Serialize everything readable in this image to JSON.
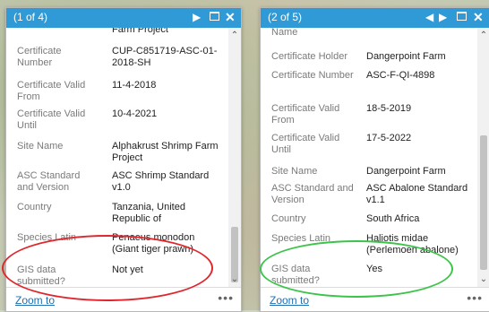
{
  "left_popup": {
    "count": "(1 of 4)",
    "partial_top": "Farm Project",
    "fields": [
      {
        "label": "Certificate Number",
        "value": "CUP-C851719-ASC-01-2018-SH"
      },
      {
        "label": "Certificate Valid From",
        "value": "11-4-2018"
      },
      {
        "label": "Certificate Valid Until",
        "value": "10-4-2021"
      },
      {
        "label": "Site Name",
        "value": "Alphakrust Shrimp Farm Project"
      },
      {
        "label": "ASC Standard and Version",
        "value": "ASC Shrimp Standard v1.0"
      },
      {
        "label": "Country",
        "value": "Tanzania, United Republic of"
      },
      {
        "label": "Species Latin",
        "value": "Penaeus monodon (Giant tiger prawn)"
      },
      {
        "label": "GIS data submitted?",
        "value": "Not yet"
      }
    ],
    "zoom_label": "Zoom to",
    "more_label": "•••"
  },
  "right_popup": {
    "count": "(2 of 5)",
    "partial_top": "Name",
    "fields": [
      {
        "label": "Certificate Holder",
        "value": "Dangerpoint Farm"
      },
      {
        "label": "Certificate Number",
        "value": "ASC-F-QI-4898"
      },
      {
        "label": "Certificate Valid From",
        "value": "18-5-2019"
      },
      {
        "label": "Certificate Valid Until",
        "value": "17-5-2022"
      },
      {
        "label": "Site Name",
        "value": "Dangerpoint Farm"
      },
      {
        "label": "ASC Standard and Version",
        "value": "ASC Abalone Standard v1.1"
      },
      {
        "label": "Country",
        "value": "South Africa"
      },
      {
        "label": "Species Latin",
        "value": "Haliotis midae (Perlemoen abalone)"
      },
      {
        "label": "GIS data submitted?",
        "value": "Yes"
      }
    ],
    "zoom_label": "Zoom to",
    "more_label": "•••"
  },
  "icons": {
    "prev": "◀",
    "next": "▶",
    "close": "✕",
    "scroll_up": "⌃",
    "scroll_down": "⌄"
  },
  "colors": {
    "header": "#2f9ad6",
    "highlight_red": "#e0262d",
    "highlight_green": "#3cc44a",
    "link": "#1f6fb2"
  }
}
